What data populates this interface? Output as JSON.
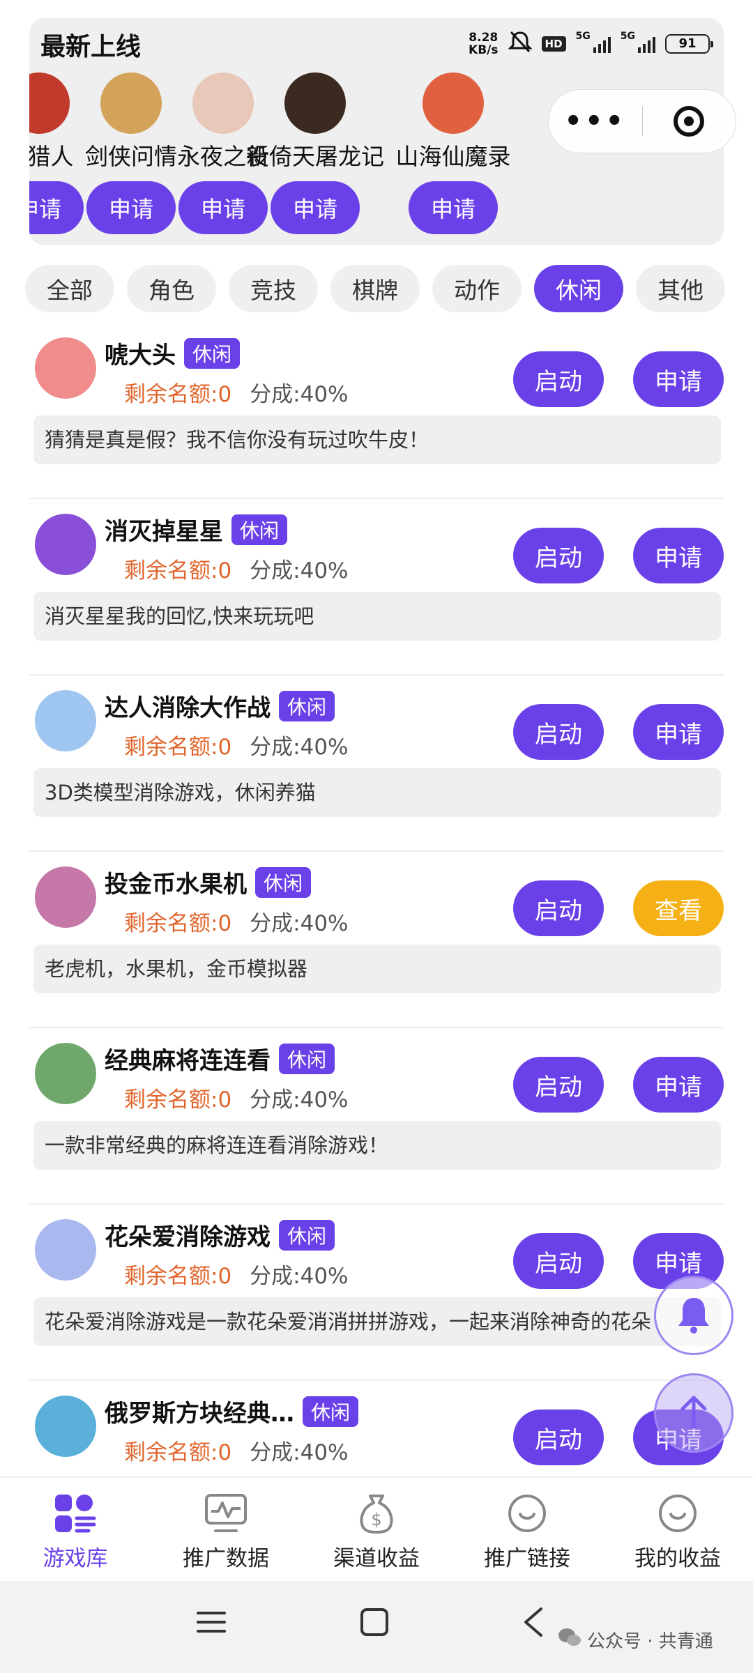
{
  "header": {
    "title": "最新上线",
    "status": {
      "net_speed_value": "8.28",
      "net_speed_unit": "KB/s",
      "hd": "HD",
      "sig1": "5G",
      "sig2": "5G",
      "battery": "91"
    }
  },
  "new_games": [
    {
      "name": "猎猎人",
      "btn": "申请",
      "color": "#c0392b"
    },
    {
      "name": "剑侠问情",
      "btn": "申请",
      "color": "#d4a35a"
    },
    {
      "name": "永夜之役",
      "btn": "申请",
      "color": "#e8c8b8"
    },
    {
      "name": "新倚天屠龙记",
      "btn": "申请",
      "color": "#3a2a20"
    },
    {
      "name": "山海仙魔录",
      "btn": "申请",
      "color": "#e06040"
    }
  ],
  "tabs": [
    "全部",
    "角色",
    "竞技",
    "棋牌",
    "动作",
    "休闲",
    "其他"
  ],
  "active_tab": "休闲",
  "games": [
    {
      "name": "唬大头",
      "tag": "休闲",
      "quota": "剩余名额:0",
      "share": "分成:40%",
      "start": "启动",
      "action": "申请",
      "desc": "猜猜是真是假？我不信你没有玩过吹牛皮！",
      "color": "#f08c8c"
    },
    {
      "name": "消灭掉星星",
      "tag": "休闲",
      "quota": "剩余名额:0",
      "share": "分成:40%",
      "start": "启动",
      "action": "申请",
      "desc": "消灭星星我的回忆,快来玩玩吧",
      "color": "#8a4fd8"
    },
    {
      "name": "达人消除大作战",
      "tag": "休闲",
      "quota": "剩余名额:0",
      "share": "分成:40%",
      "start": "启动",
      "action": "申请",
      "desc": "3D类模型消除游戏，休闲养猫",
      "color": "#9fc6f0"
    },
    {
      "name": "投金币水果机",
      "tag": "休闲",
      "quota": "剩余名额:0",
      "share": "分成:40%",
      "start": "启动",
      "action": "查看",
      "desc": "老虎机，水果机，金币模拟器",
      "color": "#c678a8"
    },
    {
      "name": "经典麻将连连看",
      "tag": "休闲",
      "quota": "剩余名额:0",
      "share": "分成:40%",
      "start": "启动",
      "action": "申请",
      "desc": "一款非常经典的麻将连连看消除游戏！",
      "color": "#6fa86a"
    },
    {
      "name": "花朵爱消除游戏",
      "tag": "休闲",
      "quota": "剩余名额:0",
      "share": "分成:40%",
      "start": "启动",
      "action": "申请",
      "desc": "花朵爱消除游戏是一款花朵爱消消拼拼游戏，一起来消除神奇的花朵",
      "color": "#a9b8ef"
    },
    {
      "name": "俄罗斯方块经典…",
      "tag": "休闲",
      "quota": "剩余名额:0",
      "share": "分成:40%",
      "start": "启动",
      "action": "申请",
      "desc": "",
      "color": "#5ab0d8"
    }
  ],
  "bottom_nav": [
    {
      "label": "游戏库",
      "icon": "game-library-icon",
      "active": true
    },
    {
      "label": "推广数据",
      "icon": "stats-monitor-icon",
      "active": false
    },
    {
      "label": "渠道收益",
      "icon": "money-bag-icon",
      "active": false
    },
    {
      "label": "推广链接",
      "icon": "smile-link-icon",
      "active": false
    },
    {
      "label": "我的收益",
      "icon": "smile-earnings-icon",
      "active": false
    }
  ],
  "watermark": "公众号 · 共青通",
  "colors": {
    "accent": "#6a40e8",
    "view": "#f5b015",
    "quota": "#e0662d"
  }
}
